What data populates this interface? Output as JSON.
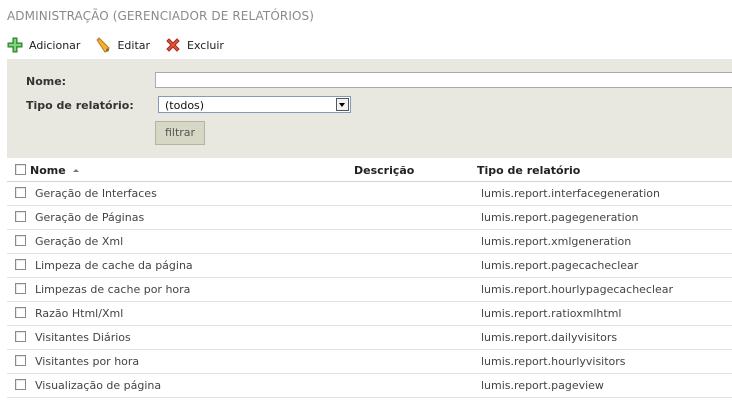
{
  "page": {
    "title": "ADMINISTRAÇÃO (GERENCIADOR DE RELATÓRIOS)"
  },
  "toolbar": {
    "add_label": "Adicionar",
    "edit_label": "Editar",
    "delete_label": "Excluir",
    "icons": {
      "add": "plus-icon",
      "edit": "pencil-icon",
      "delete": "delete-x-icon"
    }
  },
  "filter": {
    "name_label": "Nome:",
    "name_value": "",
    "type_label": "Tipo de relatório:",
    "type_selected": "(todos)",
    "button_label": "filtrar"
  },
  "table": {
    "columns": [
      "Nome",
      "Descrição",
      "Tipo de relatório"
    ],
    "sort_column": "Nome",
    "sort_direction": "ascending",
    "rows": [
      {
        "nome": "Geração de Interfaces",
        "descricao": "",
        "tipo": "lumis.report.interfacegeneration"
      },
      {
        "nome": "Geração de Páginas",
        "descricao": "",
        "tipo": "lumis.report.pagegeneration"
      },
      {
        "nome": "Geração de Xml",
        "descricao": "",
        "tipo": "lumis.report.xmlgeneration"
      },
      {
        "nome": "Limpeza de cache da página",
        "descricao": "",
        "tipo": "lumis.report.pagecacheclear"
      },
      {
        "nome": "Limpezas de cache por hora",
        "descricao": "",
        "tipo": "lumis.report.hourlypagecacheclear"
      },
      {
        "nome": "Razão Html/Xml",
        "descricao": "",
        "tipo": "lumis.report.ratioxmlhtml"
      },
      {
        "nome": "Visitantes Diários",
        "descricao": "",
        "tipo": "lumis.report.dailyvisitors"
      },
      {
        "nome": "Visitantes por hora",
        "descricao": "",
        "tipo": "lumis.report.hourlyvisitors"
      },
      {
        "nome": "Visualização de página",
        "descricao": "",
        "tipo": "lumis.report.pageview"
      }
    ]
  },
  "colors": {
    "accent_green": "#2e9a2e",
    "delete_red": "#d23a2a",
    "filter_panel": "#e8e8e0"
  }
}
